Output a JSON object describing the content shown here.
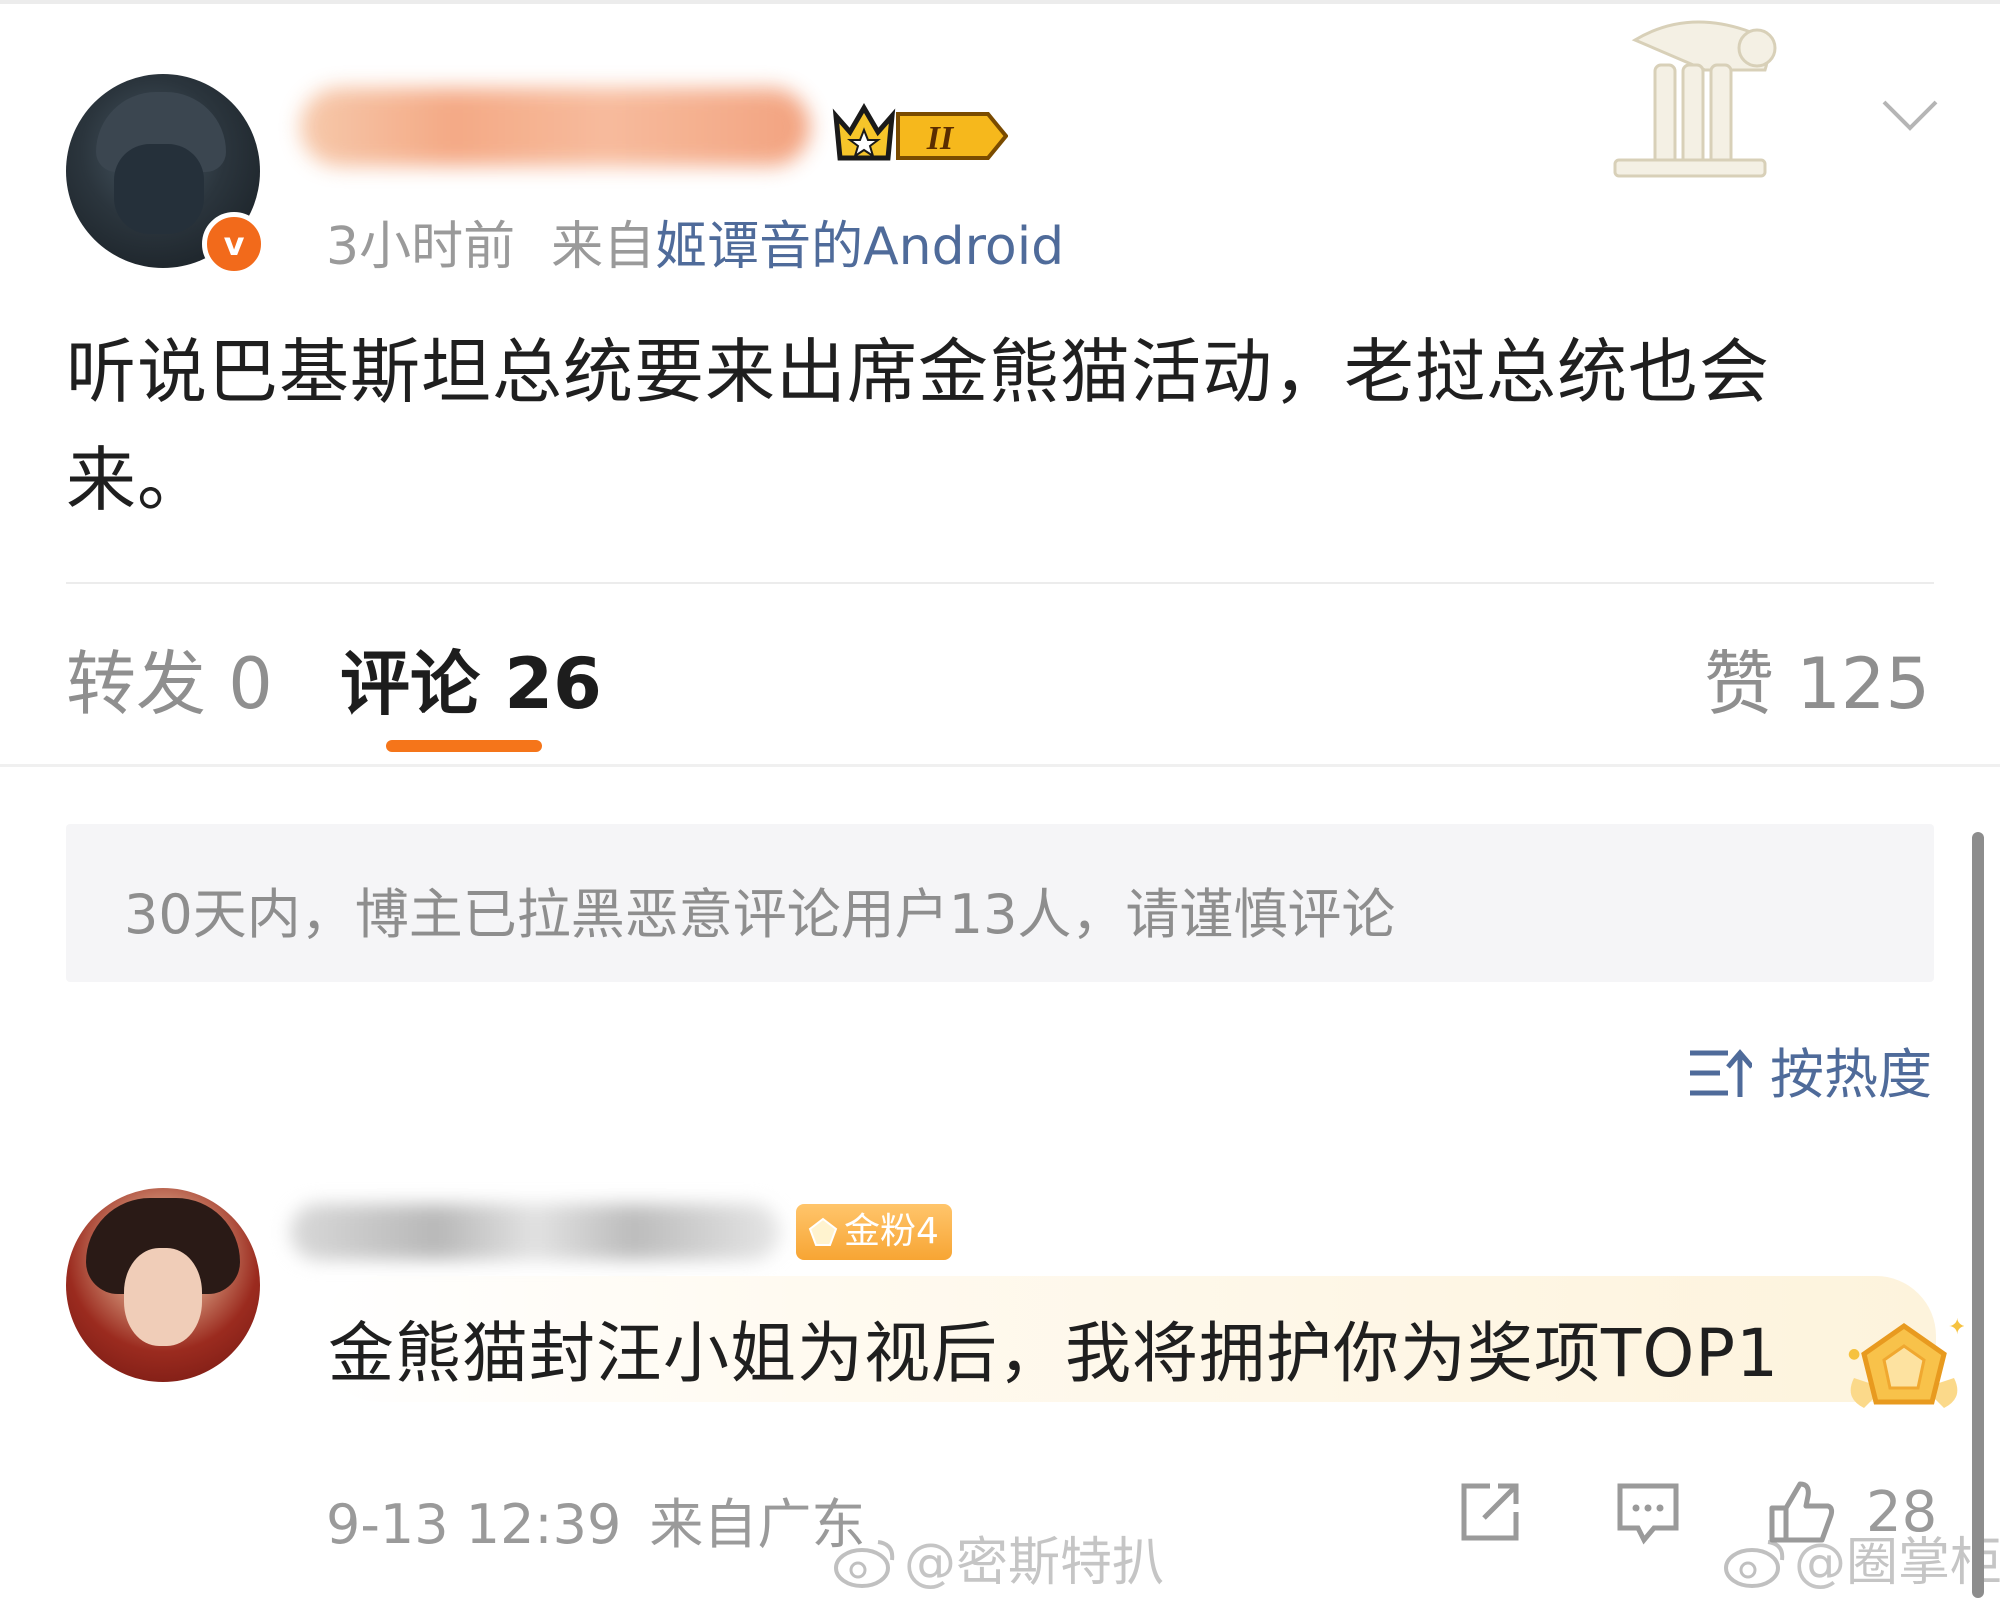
{
  "post": {
    "time": "3小时前",
    "source_prefix": "来自",
    "source_device": "姬谭音的Android",
    "badge_level": "II",
    "content": "听说巴基斯坦总统要来出席金熊猫活动，老挝总统也会来。"
  },
  "tabs": {
    "repost": "转发 0",
    "comments": "评论 26",
    "likes": "赞 125"
  },
  "notice": "30天内，博主已拉黑恶意评论用户13人，请谨慎评论",
  "sort": {
    "label": "按热度"
  },
  "comment": {
    "fan_badge": "金粉4",
    "text": "金熊猫封汪小姐为视后，我将拥护你为奖项TOP1",
    "time": "9-13 12:39",
    "location": "来自广东",
    "like_count": "28"
  },
  "watermarks": [
    "@密斯特扒",
    "@圈掌柜"
  ],
  "colors": {
    "accent_orange": "#f5751a",
    "link_blue": "#4f6b9a",
    "verified_orange": "#f26a1b",
    "fan_badge_gold": "#f7a534"
  },
  "icons": [
    "verified-icon",
    "crown-badge-icon",
    "chevron-down-icon",
    "sort-icon",
    "fan-gem-icon",
    "medal-icon",
    "share-icon",
    "reply-icon",
    "like-icon",
    "weibo-logo-icon"
  ]
}
